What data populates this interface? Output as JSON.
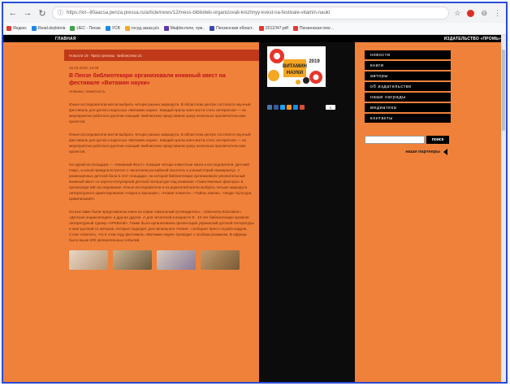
{
  "browser": {
    "url": "https://xn--80aacsa.penza.pressa.ru/article/news/12/mess-biblioteki-organizovali-knizhnyy-kvest-na-festivale-vitamin-nauki",
    "url_info": "ⓘ",
    "back_icon": "←",
    "forward_icon": "→",
    "reload_icon": "↻",
    "star_icon": "☆",
    "menu_icon": "⋮",
    "profile_icon": "⊖",
    "bookmarks": [
      {
        "label": "Яндекс",
        "color": "#e53935"
      },
      {
        "label": "Read.deyktoria",
        "color": "#1e88e5"
      },
      {
        "label": "UEC - Пенза",
        "color": "#43a047"
      },
      {
        "label": "УСВ",
        "color": "#1e88e5"
      },
      {
        "label": "госуд.заказ.р/з",
        "color": "#f9a825"
      },
      {
        "label": "Маф/м.поле, чуж..",
        "color": "#5e35b1"
      },
      {
        "label": "Пензенская област..",
        "color": "#3949ab"
      },
      {
        "label": "2011Л47.pdf",
        "color": "#e53935"
      },
      {
        "label": "Пензенская new ..",
        "color": "#e53935"
      }
    ]
  },
  "site": {
    "top_left": "ГЛАВНАЯ",
    "top_right": "ИЗДАТЕЛЬСТВО «ПРОМЬ»",
    "breadcrumb": [
      "Новости 19",
      "Пресс-релизы",
      "Библиотеки 21"
    ]
  },
  "article": {
    "date": "15.03.2019, 14:48",
    "headline": "В Пензе библиотекари организовали книжный квест на фестивале «Витамин науки»",
    "subline": "Новинки, сюжетность",
    "paragraphs": [
      "Юные исследователи могли выбрать четыре разных маршрута. В областном центре состоялся научный фестиваль для детей и взрослых «Витамин науки». Каждый зрелы взял могти стать интересное — из мероприятие работало десятки локаций. Библиотеки представили сразу несколько просветительских проектов.",
      "Юные исследователи могли выбрать четыре разных маршрута. В областном центре состоялся научный фестиваль для детей и взрослых «Витамин науки». Каждый зрелы взял могти стать интересное — из мероприятие работало десятки локаций. Библиотеки представили сразу несколько просветительских проектов.",
      "На одной из площадок — «Книжный Квэст» локации четыре известные книги и исследователи. Детский Гааус, и юный правдов встретил с писателем российской писатель и ученый Юрий Никкирангус. У размещенных детской бала в этот площадке, на которой библиотекари организовали увлекательный книжный квест со научно-популярной детской литературе под название «Таинственные факторы» в пропаганде ШЕ исследование. Юные исследователи и из родителей могли выбрать четыре маршрута литературного ориентирования «Наука в признаке», «Новая планета», «Тайны земли», «Люди. Культура. Цивилизация».",
      "На выставке были представлены книги из серии «Школьный путеводитель», «Discovery Education», «Детская энциклопедия» и другие другие. А для читателей в возрасте 9 - 10 лет библиотекари провели литературный турнир «АРКБоой». Также была организована презентация украинский детской литературы и книг русский со авторов, которые подходят для начального чтения - сообщает пресс-служба кадров. Стоит отметить, что в этом году фестиваль «Витамин науки» проводит с особым размахом. В ефрице было выше 200 увлекательных событий."
    ]
  },
  "sidebar": {
    "logo_title": "ВИТАМИН НАУКИ",
    "logo_year": "2019",
    "share_count": "0",
    "menu": [
      "новости",
      "книги",
      "авторы",
      "об издательстве",
      "наши награды",
      "медиатека",
      "контакты"
    ],
    "search_button": "поиск",
    "partners": "наши партнеры"
  }
}
